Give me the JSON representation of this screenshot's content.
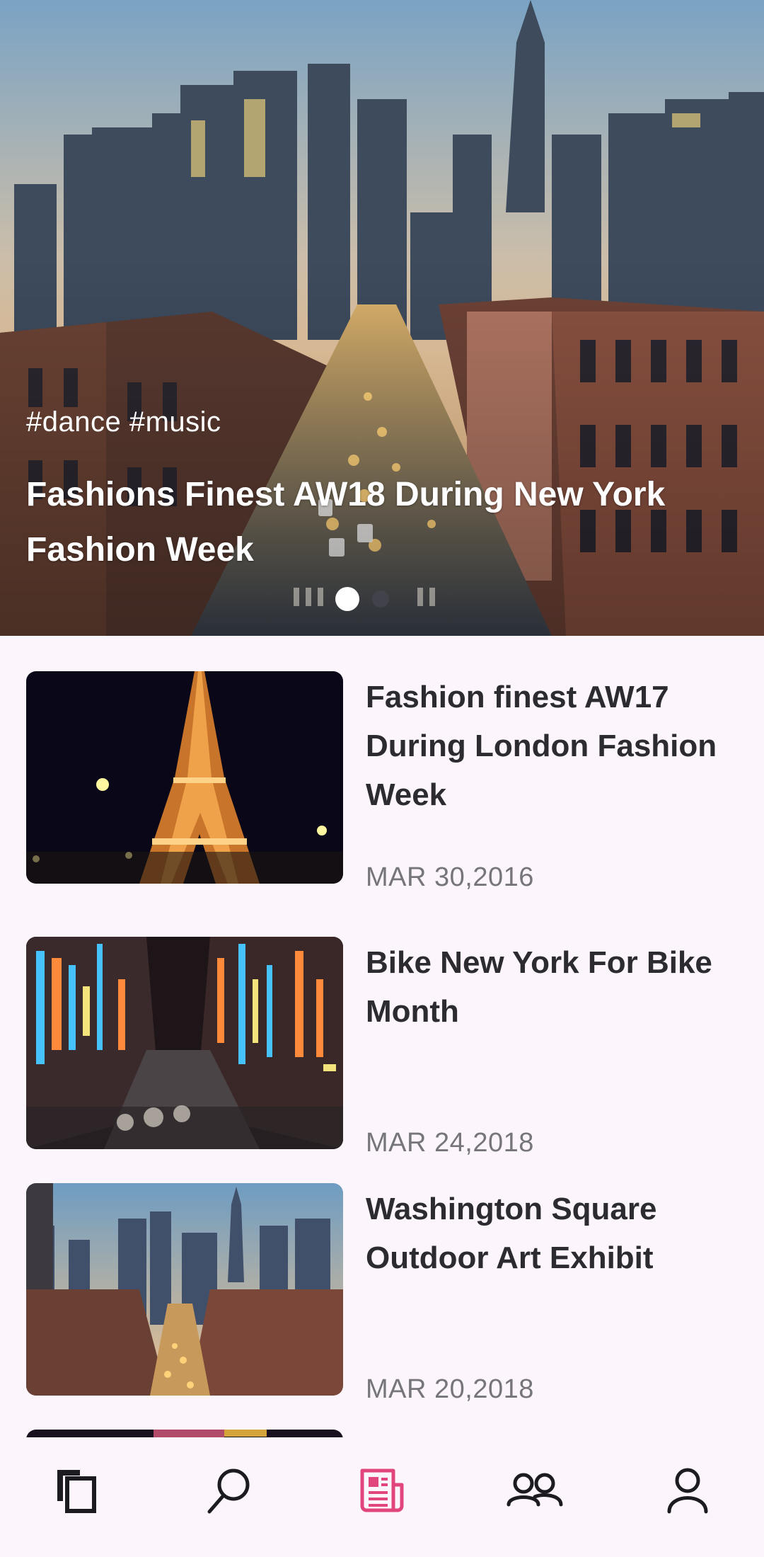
{
  "hero": {
    "tags": "#dance #music",
    "title": "Fashions Finest AW18 During New York Fashion Week",
    "carousel_page": 1,
    "carousel_total": 2
  },
  "articles": [
    {
      "title": "Fashion finest AW17 During London Fashion Week",
      "date": "MAR 30,2016",
      "image": "eiffel-tower-night"
    },
    {
      "title": "Bike New York For Bike Month",
      "date": "MAR 24,2018",
      "image": "neon-city-street"
    },
    {
      "title": "Washington Square Outdoor Art Exhibit",
      "date": "MAR 20,2018",
      "image": "city-skyline-street"
    }
  ],
  "nav": {
    "active_index": 2,
    "active_color": "#e0457b",
    "inactive_color": "#1c1b1f",
    "items": [
      {
        "icon": "pages-icon"
      },
      {
        "icon": "search-icon"
      },
      {
        "icon": "news-icon"
      },
      {
        "icon": "people-icon"
      },
      {
        "icon": "person-icon"
      }
    ]
  }
}
